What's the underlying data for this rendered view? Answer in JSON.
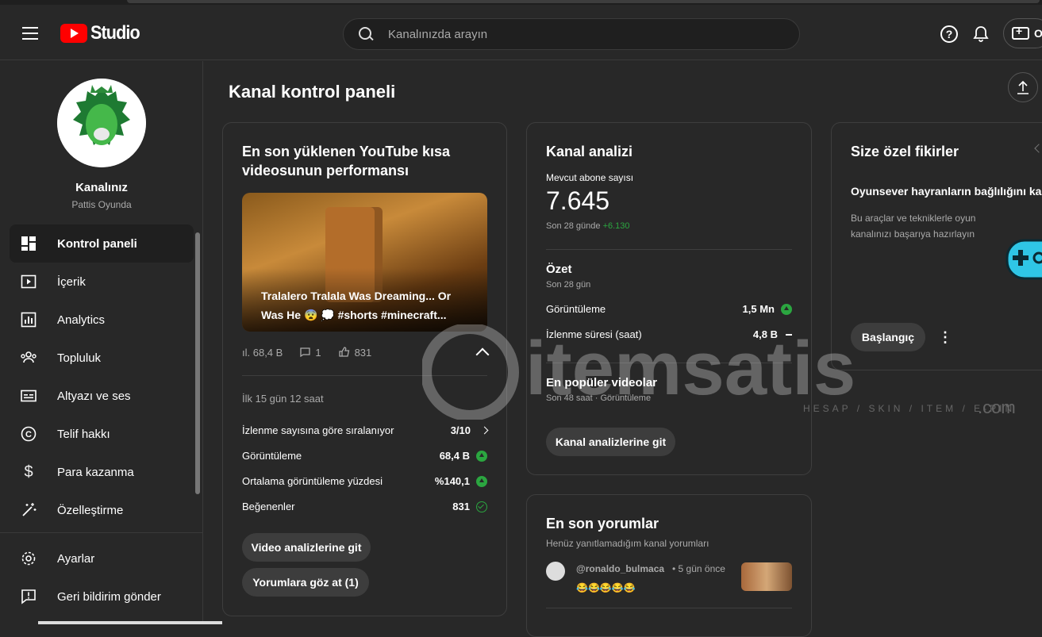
{
  "app": {
    "logo_text": "Studio"
  },
  "header": {
    "search_placeholder": "Kanalınızda arayın",
    "create_label": "O"
  },
  "channel": {
    "name": "Kanalınız",
    "handle": "Pattis Oyunda"
  },
  "sidebar": {
    "items": [
      {
        "label": "Kontrol paneli",
        "icon": "dashboard-icon",
        "active": true
      },
      {
        "label": "İçerik",
        "icon": "content-icon"
      },
      {
        "label": "Analytics",
        "icon": "analytics-icon"
      },
      {
        "label": "Topluluk",
        "icon": "community-icon"
      },
      {
        "label": "Altyazı ve ses",
        "icon": "subtitles-icon"
      },
      {
        "label": "Telif hakkı",
        "icon": "copyright-icon"
      },
      {
        "label": "Para kazanma",
        "icon": "dollar-icon"
      },
      {
        "label": "Özelleştirme",
        "icon": "magic-wand-icon"
      }
    ],
    "bottom": [
      {
        "label": "Ayarlar",
        "icon": "gear-icon"
      },
      {
        "label": "Geri bildirim gönder",
        "icon": "feedback-icon"
      }
    ]
  },
  "main": {
    "title": "Kanal kontrol paneli",
    "short_card": {
      "title": "En son yüklenen YouTube kısa videosunun performansı",
      "video_title": "Tralalero Tralala Was Dreaming... Or Was He 😨 💭 #shorts #minecraft...",
      "views": "68,4 B",
      "comments": "1",
      "likes": "831",
      "period": "İlk 15 gün 12 saat",
      "rows": [
        {
          "label": "İzlenme sayısına göre sıralanıyor",
          "value": "3/10"
        },
        {
          "label": "Görüntüleme",
          "value": "68,4 B"
        },
        {
          "label": "Ortalama görüntüleme yüzdesi",
          "value": "%140,1"
        },
        {
          "label": "Beğenenler",
          "value": "831"
        }
      ],
      "btn_analytics": "Video analizlerine git",
      "btn_comments": "Yorumlara göz at (1)"
    },
    "analytics_card": {
      "title": "Kanal analizi",
      "subs_label": "Mevcut abone sayısı",
      "subs_value": "7.645",
      "subs_period": "Son 28 günde",
      "subs_delta": "+6.130",
      "summary_title": "Özet",
      "summary_period": "Son 28 gün",
      "rows": [
        {
          "label": "Görüntüleme",
          "value": "1,5 Mn"
        },
        {
          "label": "İzlenme süresi (saat)",
          "value": "4,8 B"
        }
      ],
      "top_title": "En popüler videolar",
      "top_sub": "Son 48 saat · Görüntüleme",
      "btn": "Kanal analizlerine git"
    },
    "ideas_card": {
      "title": "Size özel fikirler",
      "headline": "Oyunsever hayranların bağlılığını kaz",
      "desc": "Bu araçlar ve tekniklerle oyun kanalınızı başarıya hazırlayın",
      "btn": "Başlangıç"
    },
    "comments_card": {
      "title": "En son yorumlar",
      "sub": "Henüz yanıtlamadığım kanal yorumları",
      "author": "@ronaldo_bulmaca",
      "time": "• 5 gün önce",
      "text": "😂😂😂😂😂"
    }
  },
  "watermark": {
    "text": "itemsatis",
    "tagline": "HESAP / SKIN / ITEM / E-PIN",
    "suffix": ".com"
  },
  "colors": {
    "accent_green": "#2ba640",
    "brand_red": "#ff0000",
    "bg": "#282828"
  }
}
